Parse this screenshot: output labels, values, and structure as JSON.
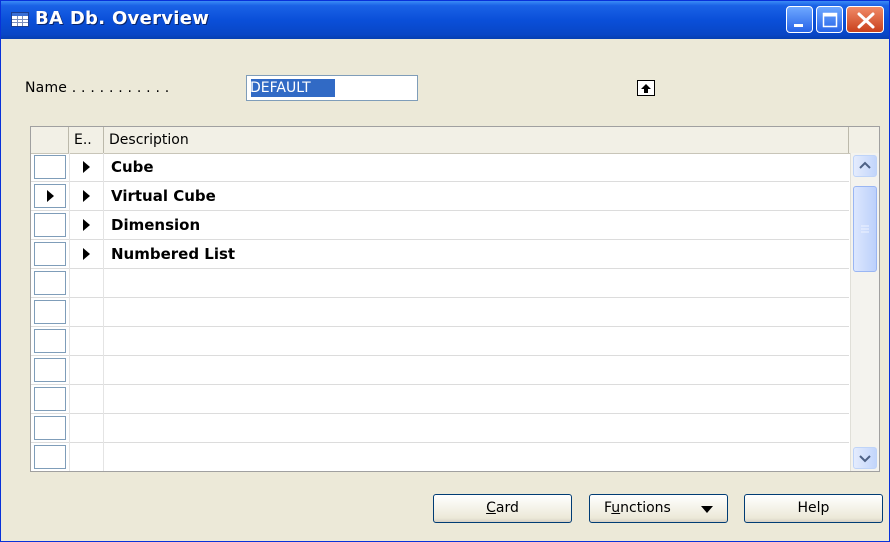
{
  "window": {
    "title": "BA Db. Overview",
    "title_icon": "table-icon",
    "controls": [
      "minimize-icon",
      "maximize-icon",
      "close-icon"
    ]
  },
  "filter": {
    "label": "Name . . . . . . . . . . .",
    "value": "DEFAULT",
    "lookup_icon": "lookup-arrow-up-icon"
  },
  "grid": {
    "columns": [
      "E..",
      "Description"
    ],
    "rows": [
      {
        "description": "Cube",
        "selected": false
      },
      {
        "description": "Virtual Cube",
        "selected": true
      },
      {
        "description": "Dimension",
        "selected": false
      },
      {
        "description": "Numbered List",
        "selected": false
      },
      {
        "description": "",
        "selected": false
      },
      {
        "description": "",
        "selected": false
      },
      {
        "description": "",
        "selected": false
      },
      {
        "description": "",
        "selected": false
      },
      {
        "description": "",
        "selected": false
      },
      {
        "description": "",
        "selected": false
      },
      {
        "description": "",
        "selected": false
      }
    ]
  },
  "buttons": {
    "card": {
      "prefix": "",
      "accel": "C",
      "rest": "ard"
    },
    "functions": {
      "prefix": "F",
      "accel": "u",
      "rest": "nctions"
    },
    "help": {
      "label": "Help"
    }
  },
  "colors": {
    "titlebar": "#0a4fd9",
    "selection": "#316ac5",
    "window_bg": "#ece9d8"
  }
}
